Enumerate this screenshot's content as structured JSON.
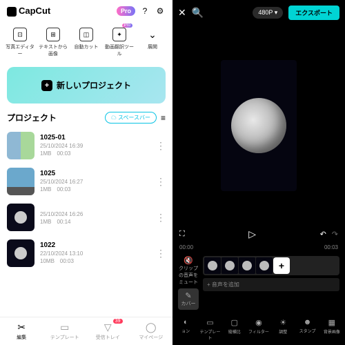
{
  "app_name": "CapCut",
  "pro_label": "Pro",
  "tools": [
    {
      "label": "写真エディター"
    },
    {
      "label": "テキストから画像"
    },
    {
      "label": "自動カット"
    },
    {
      "label": "動画翻訳ツール",
      "pro": true
    },
    {
      "label": "展開"
    }
  ],
  "new_project_label": "新しいプロジェクト",
  "section_title": "プロジェクト",
  "space_button": "スペースバー",
  "projects": [
    {
      "title": "1025-01",
      "date": "25/10/2024 16:39",
      "size": "1MB",
      "duration": "00:03"
    },
    {
      "title": "1025",
      "date": "25/10/2024 16:27",
      "size": "1MB",
      "duration": "00:03"
    },
    {
      "title": "",
      "date": "25/10/2024 16:26",
      "size": "1MB",
      "duration": "00:14"
    },
    {
      "title": "1022",
      "date": "22/10/2024 13:10",
      "size": "10MB",
      "duration": "00:03"
    }
  ],
  "bottom_nav": [
    {
      "label": "編集"
    },
    {
      "label": "テンプレート"
    },
    {
      "label": "受信トレイ",
      "badge": "39"
    },
    {
      "label": "マイページ"
    }
  ],
  "editor": {
    "resolution": "480P",
    "export": "エクスポート",
    "time_current": "00:00",
    "time_total": "00:03",
    "mute_label": "クリップの音声をミュート",
    "cover_label": "カバー",
    "add_audio": "+ 音声を追加",
    "bottom_tools": [
      "ョン",
      "テンプレート",
      "縦横比",
      "フィルター",
      "調整",
      "スタンプ",
      "背景画像"
    ]
  }
}
